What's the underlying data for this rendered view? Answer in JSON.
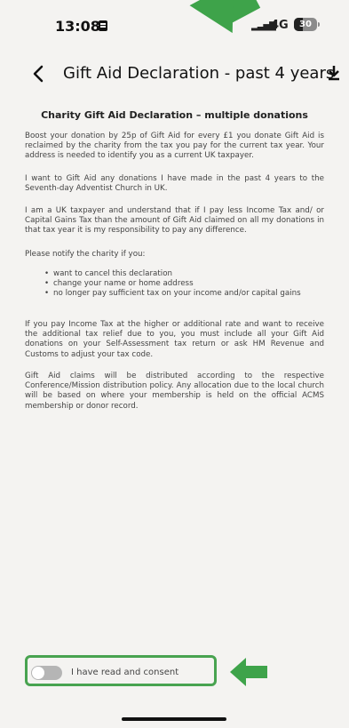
{
  "status_bar": {
    "time": "13:08",
    "network": "4G",
    "battery": "30",
    "signal_icon": "signal-bars-icon",
    "calendar_icon": "calendar-icon"
  },
  "header": {
    "title": "Gift Aid Declaration - past 4 years",
    "back_icon": "chevron-left-icon",
    "download_icon": "download-icon"
  },
  "declaration": {
    "title": "Charity Gift Aid Declaration – multiple donations",
    "paragraphs": [
      "Boost your donation by 25p of Gift Aid for every £1 you donate Gift Aid is reclaimed by the charity from the tax you pay for the current tax year. Your address is needed to identify you as a current UK taxpayer.",
      "I want to Gift Aid any donations I have made in the past 4 years to the Seventh-day Adventist Church in UK.",
      "I am a UK taxpayer and understand that if I pay less Income Tax and/ or Capital Gains Tax than the amount of Gift Aid claimed on all my donations in that tax year it is my responsibility to pay any difference.",
      "Please notify the charity if you:"
    ],
    "bullets": [
      "want to cancel this declaration",
      "change your name or home address",
      "no longer pay sufficient tax on your income and/or capital gains"
    ],
    "after_paragraphs": [
      "If you pay Income Tax at the higher or additional rate and want to receive the additional tax relief due to you, you must include all your Gift Aid donations on your Self-Assessment tax return or ask HM Revenue and Customs to adjust your tax code.",
      "Gift Aid claims will be distributed according to the respective Conference/Mission distribution policy. Any allocation due to the local church will be based on where your membership is held on the official ACMS membership or donor record."
    ]
  },
  "consent": {
    "label": "I have read and consent",
    "checked": false
  },
  "colors": {
    "annotation": "#3ea34a",
    "background": "#f4f3f1"
  }
}
